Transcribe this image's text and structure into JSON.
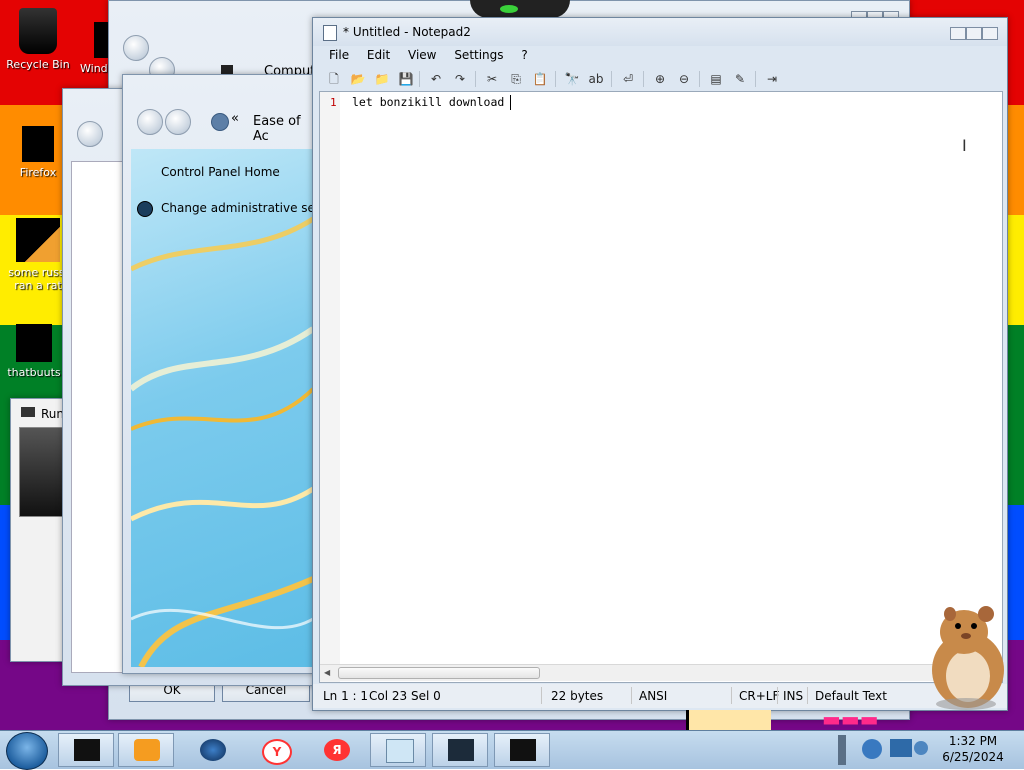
{
  "desktop": {
    "icons": [
      {
        "label": "Recycle Bin"
      },
      {
        "label": "Wind"
      },
      {
        "label": "Firefox"
      },
      {
        "label": "some russi"
      },
      {
        "label": "ran a rat"
      },
      {
        "label": "thatbuuts"
      }
    ]
  },
  "bg_windows": {
    "computer_title": "Comput",
    "ease_title": "Ease of Ac",
    "run_title": "Run",
    "nav_back": "«",
    "control_panel_home": "Control Panel Home",
    "change_admin": "Change administrative settin",
    "ok_label": "OK",
    "cancel_label": "Cancel"
  },
  "notepad": {
    "title": "* Untitled - Notepad2",
    "menu": [
      "File",
      "Edit",
      "View",
      "Settings",
      "?"
    ],
    "line_number": "1",
    "content": "let bonzikill download",
    "status": {
      "position": "Ln 1 : 1",
      "col": "Col 23",
      "sel": "Sel 0",
      "size": "22 bytes",
      "encoding": "ANSI",
      "eol": "CR+LF",
      "mode": "INS",
      "scheme": "Default Text"
    }
  },
  "taskbar": {
    "time": "1:32 PM",
    "date": "6/25/2024"
  },
  "colors": {
    "accent": "#3c7fb1",
    "line_number": "#c00000"
  }
}
